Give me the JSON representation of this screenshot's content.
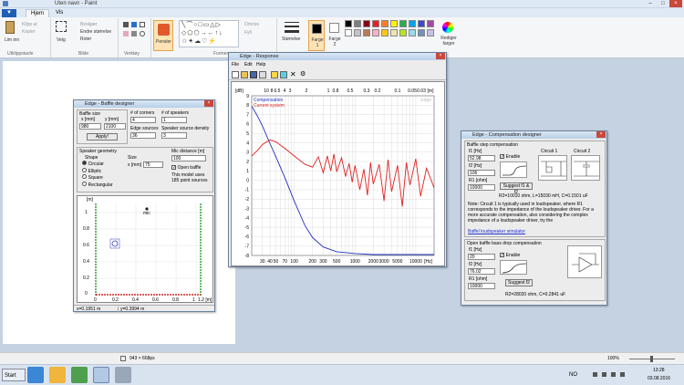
{
  "paint": {
    "title": "Uten navn - Paint",
    "file_tab": "▼",
    "tabs": [
      "Hjem",
      "Vis"
    ],
    "clipboard": {
      "paste": "Lim inn",
      "cut": "Klipp ut",
      "copy": "Kopier",
      "label": "Utklippstavle"
    },
    "image": {
      "select": "Velg",
      "crop": "Beskjær",
      "resize": "Endre størrelse",
      "rotate": "Roter",
      "label": "Bilde"
    },
    "tools_label": "Verktøy",
    "brushes": "Pensler",
    "shapes": {
      "outline": "Omriss",
      "fill": "Fyll",
      "label": "Former"
    },
    "size": "Størrelse",
    "color1": "Farge 1",
    "color2": "Farge 2",
    "edit_colors": "Rediger farger",
    "palette": [
      "#000000",
      "#7f7f7f",
      "#880015",
      "#ed1c24",
      "#ff7f27",
      "#fff200",
      "#22b14c",
      "#00a2e8",
      "#3f48cc",
      "#a349a4",
      "#ffffff",
      "#c3c3c3",
      "#b97a57",
      "#ffaec9",
      "#ffc90e",
      "#efe4b0",
      "#b5e61d",
      "#99d9ea",
      "#7092be",
      "#c8bfe7"
    ],
    "status_size": "943 × 668px",
    "zoom": "100%"
  },
  "baffle": {
    "title": "Edge - Baffle designer",
    "baffle_size": "Baffle size",
    "x_label": "x [mm]",
    "y_label": "y [mm]",
    "x_val": "980",
    "y_val": "2100",
    "apply": "Apply!",
    "corners_label": "# of corners",
    "corners_val": "4",
    "edge_sources_label": "Edge sources",
    "edge_sources_val": "36",
    "speakers_label": "# of speakers",
    "speakers_val": "1",
    "density_label": "Speaker source density",
    "density_val": "3",
    "geometry": "Speaker geometry",
    "shape": "Shape",
    "shapes": [
      "Circular",
      "Elliptic",
      "Square",
      "Rectangular"
    ],
    "size": "Size",
    "size_x_label": "x [mm]",
    "size_x_val": "75",
    "mic_label": "Mic distance [m]",
    "mic_val": "100",
    "open_baffle": "Open baffle",
    "info": "This model uses 185 point sources",
    "plot_m": "[m]",
    "mic_text": "mic",
    "yticks": [
      "1",
      "0.8",
      "0.6",
      "0.4",
      "0.2",
      "0"
    ],
    "xticks": [
      "0",
      "0.2",
      "0.4",
      "0.6",
      "0.8",
      "1",
      "1.2 [m]"
    ],
    "status_x": "x=0.1951 m",
    "status_y": "y=0.3994 m"
  },
  "response": {
    "title": "Edge - Response",
    "menu": [
      "File",
      "Edit",
      "Help"
    ],
    "top_unit": "[dB]",
    "top_ticks": [
      "10",
      "8",
      "6.5",
      "4",
      "3",
      "2",
      "1",
      "0.8",
      "0.5",
      "0.3",
      "0.2",
      "0.1",
      "0.05",
      "0.03",
      "[m]"
    ],
    "legend": [
      "Compensation",
      "Current system"
    ],
    "watermark": "Edge",
    "yticks": [
      "9",
      "8",
      "7",
      "6",
      "5",
      "4",
      "3",
      "2",
      "1",
      "0",
      "-1",
      "-2",
      "-3",
      "-4",
      "-5",
      "-6",
      "-7",
      "-8"
    ],
    "xticks": [
      "30",
      "40",
      "50",
      "70",
      "100",
      "200",
      "300",
      "500",
      "1000",
      "2000",
      "3000",
      "5000",
      "10000",
      "[Hz]"
    ]
  },
  "chart_data": {
    "type": "line",
    "xlabel": "[Hz]",
    "ylabel": "[dB]",
    "xlim": [
      20,
      20000
    ],
    "ylim": [
      -8,
      9
    ],
    "log_x": true,
    "series": [
      {
        "name": "Compensation",
        "color": "#2030c0",
        "x": [
          20,
          25,
          30,
          40,
          50,
          70,
          100,
          150,
          200,
          300,
          500,
          1000,
          2000,
          5000,
          20000
        ],
        "y": [
          7.9,
          6.8,
          5.8,
          3.9,
          2.5,
          0.3,
          -2.2,
          -4.8,
          -6.1,
          -7.1,
          -7.6,
          -7.8,
          -7.9,
          -7.9,
          -7.9
        ]
      },
      {
        "name": "Current system",
        "color": "#e02020",
        "x": [
          20,
          25,
          30,
          40,
          50,
          70,
          100,
          150,
          200,
          250,
          300,
          350,
          400,
          450,
          500,
          600,
          700,
          800,
          900,
          1000,
          1200,
          1400,
          1600,
          1800,
          2000,
          2500,
          3000,
          3500,
          4000,
          5000,
          6000,
          7000,
          8000,
          10000,
          12000,
          15000,
          20000
        ],
        "y": [
          2.6,
          3.2,
          3.8,
          4.3,
          4.1,
          3.4,
          2.6,
          1.7,
          1.4,
          2.5,
          0.8,
          2.6,
          1.0,
          2.8,
          0.9,
          2.4,
          0.4,
          1.8,
          -0.2,
          1.6,
          -1.0,
          1.2,
          -1.6,
          1.9,
          -0.4,
          1.7,
          -2.2,
          2.2,
          -1.2,
          1.6,
          -2.8,
          1.9,
          -0.5,
          2.3,
          -1.7,
          1.3,
          -0.8
        ]
      }
    ]
  },
  "comp": {
    "title": "Edge - Compensation designer",
    "section1": "Baffle step compensation",
    "f1_label": "f1 [Hz]",
    "f1_val": "52.98",
    "enable": "Enable",
    "f2_label": "f2 [Hz]",
    "f2_val": "106",
    "r1_label": "R1 [ohm]",
    "r1_val": "10000",
    "suggest1": "Suggest f1 & f2",
    "circuit1": "Circuit 1",
    "circuit2": "Circuit 2",
    "result1": "R2=10010 ohm, L=15030 mH, C=0.1501 uF",
    "note": "Note: Circuit 1 is typically used in loudspeaker, where R1 corresponds to the impedance of the loudspeaker driver. For a more accurate compensation, also considering the complex impedance of a loudspeaker driver, try the",
    "link": "Baffel loudspeaker simulator",
    "section2": "Open baffle bass drop compensation",
    "f1b_label": "f1 [Hz]",
    "f1b_val": "20",
    "enable2": "Enable",
    "f2b_label": "f2 [Hz]",
    "f2b_val": "76.02",
    "r1b_label": "R1 [ohm]",
    "r1b_val": "10000",
    "suggest2": "Suggest f2",
    "result2": "R2=28020 ohm, C=0.2841 uF"
  },
  "taskbar": {
    "start": "Start",
    "lang": "NO",
    "time": "13:28",
    "date": "03.08.2016"
  }
}
